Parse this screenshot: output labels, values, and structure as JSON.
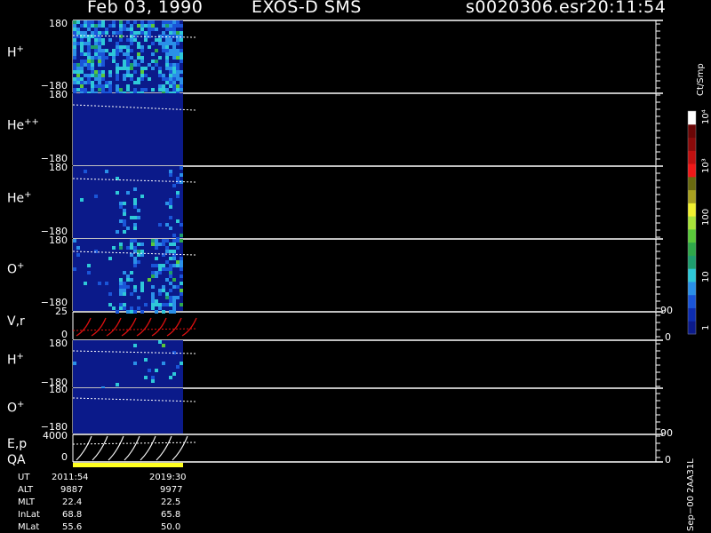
{
  "header": {
    "date": "Feb 03, 1990",
    "instrument": "EXOS-D SMS",
    "file": "s0020306.esr",
    "time": "20:11:54"
  },
  "panels": [
    {
      "id": "h-plus",
      "label_base": "H",
      "label_sup": "+",
      "ticks_top": "180",
      "ticks_bottom": "−180"
    },
    {
      "id": "he-plus-plus",
      "label_base": "He",
      "label_sup": "++",
      "ticks_top": "180",
      "ticks_bottom": "−180"
    },
    {
      "id": "he-plus",
      "label_base": "He",
      "label_sup": "+",
      "ticks_top": "180",
      "ticks_bottom": "−180"
    },
    {
      "id": "o-plus",
      "label_base": "O",
      "label_sup": "+",
      "ticks_top": "180",
      "ticks_bottom": "−180"
    },
    {
      "id": "vr",
      "label_base": "V,r",
      "label_sup": "",
      "ticks_top": "25",
      "ticks_bottom": "0",
      "right_top": "90",
      "right_bottom": "0"
    },
    {
      "id": "h-plus-2",
      "label_base": "H",
      "label_sup": "+",
      "ticks_top": "180",
      "ticks_bottom": "−180"
    },
    {
      "id": "o-plus-2",
      "label_base": "O",
      "label_sup": "+",
      "ticks_top": "180",
      "ticks_bottom": "−180"
    },
    {
      "id": "ep",
      "label_base": "E,p",
      "label_sup": "",
      "ticks_top": "4000",
      "ticks_bottom": "0",
      "right_top": "90",
      "right_bottom": "0"
    }
  ],
  "qa_label": "QA",
  "colorbar": {
    "unit": "Ct/Smp",
    "labels": [
      "1",
      "10",
      "100",
      "10³",
      "10⁴"
    ],
    "colors": [
      "#0b1a8a",
      "#0d2db0",
      "#1a55d8",
      "#2a90e8",
      "#2ec8d8",
      "#1e9e6e",
      "#2fa84a",
      "#5ac83a",
      "#a8e23a",
      "#f0f030",
      "#a8a020",
      "#6a6a10",
      "#f01818",
      "#c01010",
      "#8a0a0a",
      "#6a0606",
      "#ffffff"
    ]
  },
  "orbit": {
    "rows": [
      "UT",
      "ALT",
      "MLT",
      "InLat",
      "MLat"
    ],
    "columns": [
      [
        "2011:54",
        "9887",
        "22.4",
        "68.8",
        "55.6"
      ],
      [
        "2019:30",
        "9977",
        "22.5",
        "65.8",
        "50.0"
      ]
    ]
  },
  "side_label": "Sep−00  2AA31L",
  "chart_data": {
    "type": "heatmap",
    "title": "Feb 03, 1990   EXOS-D SMS",
    "xlabel": "UT",
    "x_ticks": [
      "2011:54",
      "2019:30"
    ],
    "panels": [
      {
        "name": "H+",
        "ylim": [
          -180,
          180
        ]
      },
      {
        "name": "He++",
        "ylim": [
          -180,
          180
        ]
      },
      {
        "name": "He+",
        "ylim": [
          -180,
          180
        ]
      },
      {
        "name": "O+",
        "ylim": [
          -180,
          180
        ]
      },
      {
        "name": "V,r",
        "ylim": [
          0,
          25
        ],
        "right_ylim": [
          0,
          90
        ]
      },
      {
        "name": "H+",
        "ylim": [
          -180,
          180
        ]
      },
      {
        "name": "O+",
        "ylim": [
          -180,
          180
        ]
      },
      {
        "name": "E,p",
        "ylim": [
          0,
          4000
        ],
        "right_ylim": [
          0,
          90
        ]
      }
    ],
    "color_scale": {
      "unit": "Ct/Smp",
      "scale": "log",
      "range": [
        1,
        10000
      ]
    }
  }
}
